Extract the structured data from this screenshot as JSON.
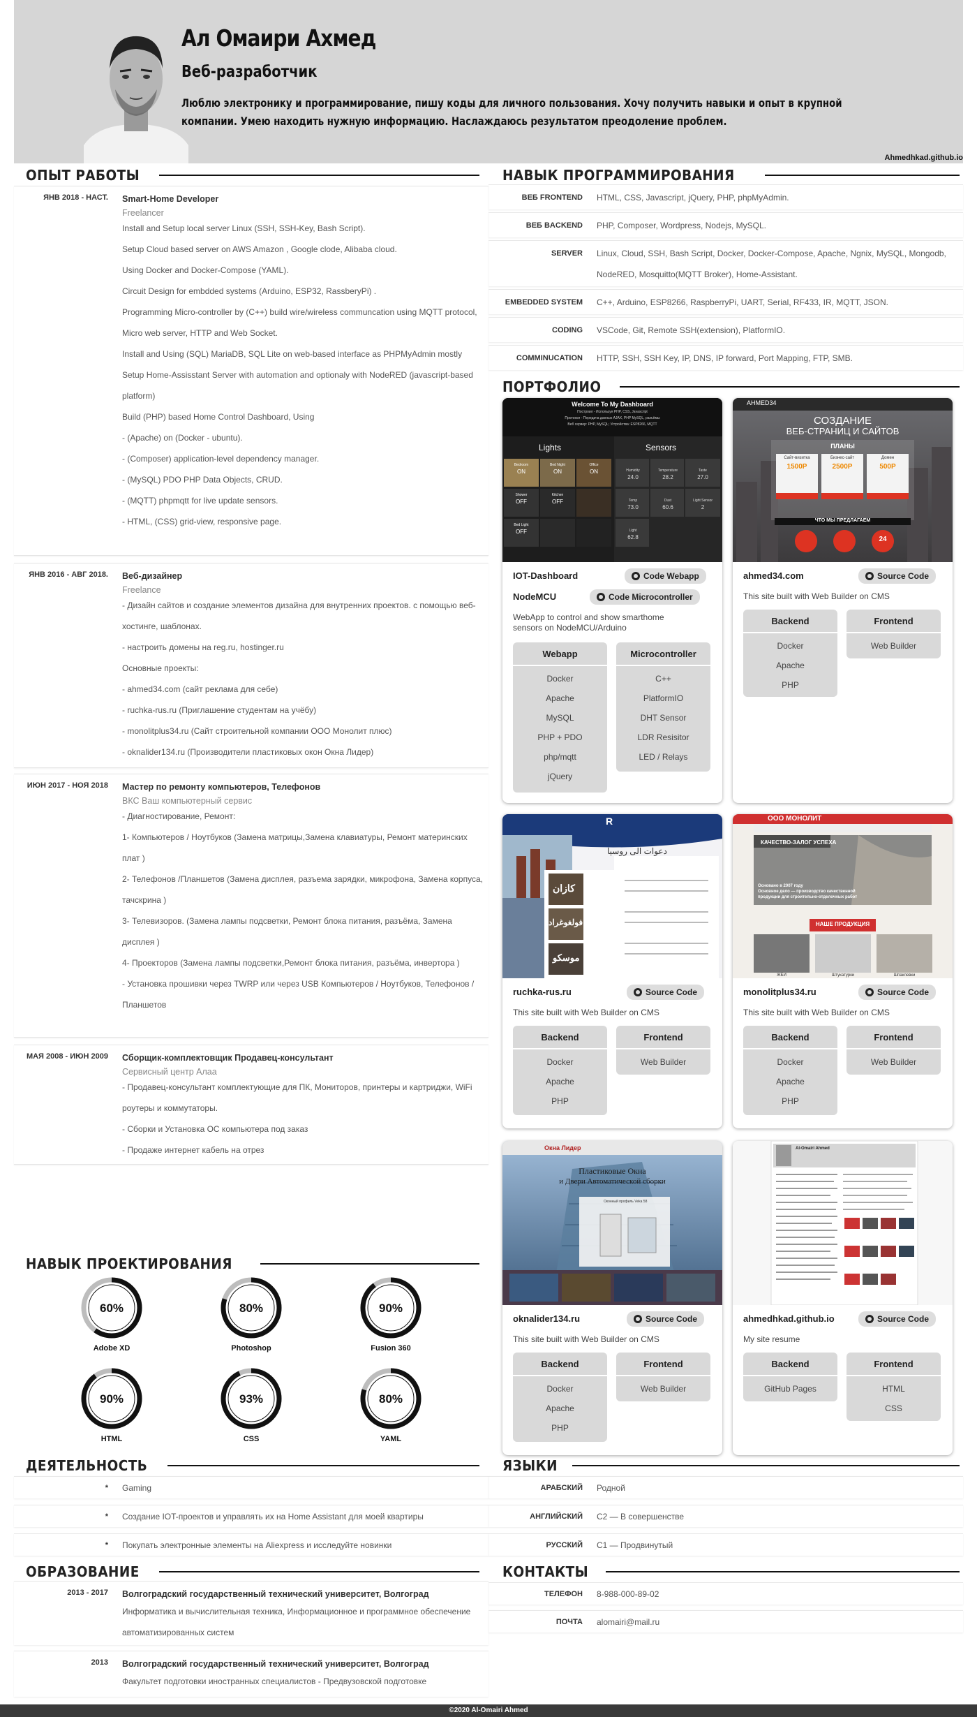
{
  "header": {
    "name": "Ал Омаири Ахмед",
    "title": "Веб-разработчик",
    "about": "Люблю электронику и программирование, пишу коды для личного пользования. Хочу получить навыки и опыт в крупной компании. Умею находить нужную информацию. Наслаждаюсь результатом преодоление проблем.",
    "site": "Ahmedhkad.github.io"
  },
  "sections": {
    "work": "ОПЫТ РАБОТЫ",
    "programming": "НАВЫК ПРОГРАММИРОВАНИЯ",
    "portfolio": "ПОРТФОЛИО",
    "design": "НАВЫК ПРОЕКТИРОВАНИЯ",
    "activity": "ДЕЯТЕЛЬНОСТЬ",
    "languages": "ЯЗЫКИ",
    "education": "ОБРАЗОВАНИЕ",
    "contacts": "КОНТАКТЫ"
  },
  "jobs": [
    {
      "date": "ЯНВ 2018 - НАСТ.",
      "role": "Smart-Home Developer",
      "company": "Freelancer",
      "lines": [
        "Install and Setup local server Linux (SSH, SSH-Key, Bash Script).",
        "Setup Cloud based server on AWS Amazon , Google clode, Alibaba cloud.",
        "Using Docker and Docker-Compose (YAML).",
        "Circuit Design for embdded systems (Arduino, ESP32, RassberyPi) .",
        "Programming Micro-controller by (C++) build wire/wireless communcation using MQTT protocol, Micro web server, HTTP and Web Socket.",
        "Install and Using (SQL) MariaDB, SQL Lite on web-based interface as PHPMyAdmin mostly",
        "Setup Home-Assisstant Server with automation and optionaly with NodeRED (javascript-based platform)",
        "Build (PHP) based Home Control Dashboard, Using",
        "- (Apache) on (Docker - ubuntu).",
        "- (Composer) application-level dependency manager.",
        "- (MySQL) PDO PHP Data Objects, CRUD.",
        "- (MQTT) phpmqtt for live update sensors.",
        "- HTML, (CSS) grid-view, responsive page."
      ]
    },
    {
      "date": "ЯНВ 2016 - АВГ 2018.",
      "role": "Веб-дизайнер",
      "company": "Freelance",
      "lines": [
        "- Дизайн сайтов и создание элементов дизайна для внутренних проектов. с помощью веб-хостинге, шаблонах.",
        "- настроить домены на reg.ru, hostinger.ru",
        "Основные проекты:",
        "- ahmed34.com (сайт реклама для себе)",
        "- ruchka-rus.ru (Приглашение студентам на учёбу)",
        "- monolitplus34.ru (Сайт строительной компании ООО Монолит плюс)",
        "- oknalider134.ru (Производители пластиковых окон Окна Лидер)"
      ]
    },
    {
      "date": "ИЮН 2017 - НОЯ 2018",
      "role": "Мастер по ремонту компьютеров, Телефонов",
      "company": "ВКС Ваш компьютерный сервис",
      "lines": [
        "- Диагностирование, Ремонт:",
        "1- Компьютеров / Ноутбуков (Замена матрицы,Замена клавиатуры, Ремонт материнских плат )",
        "2- Телефонов /Планшетов (Замена дисплея, разъема зарядки, микрофона, Замена корпуса, тачскрина )",
        "3- Телевизоров. (Замена лампы подсветки, Ремонт блока питания, разъёма, Замена дисплея )",
        "4- Проекторов (Замена лампы подсветки,Ремонт блока питания, разъёма, инвертора )",
        "- Установка прошивки через TWRP или через USB Компьютеров / Ноутбуков, Телефонов /Планшетов"
      ]
    },
    {
      "date": "МАЯ 2008 - ИЮН 2009",
      "role": "Сборщик-комплектовщик Продавец-консультант",
      "company": "Сервисный центр Алаа",
      "lines": [
        "- Продавец-консультант комплектующие для ПК, Мониторов, принтеры и картриджи, WiFi роутеры и коммутаторы.",
        "- Сборки и Установка ОС компьютера под заказ",
        "- Продаже интернет кабель на отрез"
      ]
    }
  ],
  "programming": [
    {
      "key": "ВЕБ FRONTEND",
      "value": "HTML, CSS, Javascript, jQuery, PHP, phpMyAdmin."
    },
    {
      "key": "ВЕБ BACKEND",
      "value": "PHP, Composer, Wordpress, Nodejs, MySQL."
    },
    {
      "key": "SERVER",
      "value": "Linux, Cloud, SSH, Bash Script, Docker, Docker-Compose, Apache, Ngnix, MySQL, Mongodb, NodeRED, Mosquitto(MQTT Broker), Home-Assistant."
    },
    {
      "key": "EMBEDDED SYSTEM",
      "value": "C++, Arduino, ESP8266, RaspberryPi, UART, Serial, RF433, IR, MQTT, JSON."
    },
    {
      "key": "CODING",
      "value": "VSCode, Git, Remote SSH(extension), PlatformIO."
    },
    {
      "key": "COMMINUCATION",
      "value": "HTTP, SSH, SSH Key, IP, DNS, IP forward, Port Mapping, FTP, SMB."
    }
  ],
  "portfolio": [
    {
      "name": "IOT-Dashboard",
      "btn": "Code Webapp",
      "name2": "NodeMCU",
      "btn2": "Code Microcontroller",
      "desc": "WebApp to control and show smarthome sensors on NodeMCU/Arduino",
      "backend_title": "Webapp",
      "backend": [
        "Docker",
        "Apache",
        "MySQL",
        "PHP + PDO",
        "php/mqtt",
        "jQuery"
      ],
      "frontend_title": "Microcontroller",
      "frontend": [
        "C++",
        "PlatformIO",
        "DHT Sensor",
        "LDR Resisitor",
        "LED / Relays"
      ],
      "shot": {
        "title": "Welcome To My Dashboard",
        "sub1": "Построил - Используя PHP, CSS, Javascript",
        "sub2": "Протокол - Передача данных AJAX, PHP MySQL, разъёмы",
        "sub3": "Веб сервер: PHP, MySQL; Устройства: ESP8266, MQTT",
        "lights": "Lights",
        "sensors": "Sensors",
        "tiles": [
          [
            "Bedroom",
            "ON"
          ],
          [
            "Bed Night",
            "ON"
          ],
          [
            "Office",
            "ON"
          ],
          [
            "Bed Light",
            "OFF"
          ],
          [
            "Shower",
            "OFF"
          ],
          [
            "Kitchen",
            "OFF"
          ]
        ],
        "sensor_tiles": [
          [
            "Humidity",
            "24.0"
          ],
          [
            "Temperature",
            "28.2"
          ],
          [
            "Taste",
            "27.0"
          ],
          [
            "Temp",
            "73.0"
          ],
          [
            "Dust",
            "60.6"
          ],
          [
            "Light Sensor",
            "2"
          ],
          [
            "Light",
            "62.8"
          ]
        ]
      }
    },
    {
      "name": "ahmed34.com",
      "btn": "Source Code",
      "desc": "This site built with Web Builder on CMS",
      "backend_title": "Backend",
      "backend": [
        "Docker",
        "Apache",
        "PHP"
      ],
      "frontend_title": "Frontend",
      "frontend": [
        "Web Builder"
      ],
      "shot": {
        "brand": "AHMED34",
        "head1": "СОЗДАНИЕ",
        "head2": "ВЕБ-СТРАНИЦ И САЙТОВ",
        "plans": "ПЛАНЫ",
        "p1": "Сайт-визитка",
        "p1v": "1500Р",
        "p2": "Бизнес-сайт",
        "p2v": "2500Р",
        "p3": "Домен",
        "p3v": "500Р",
        "offer": "ЧТО МЫ ПРЕДЛАГАЕМ",
        "badge": "24"
      }
    },
    {
      "name": "ruchka-rus.ru",
      "btn": "Source Code",
      "desc": "This site built with Web Builder on CMS",
      "backend_title": "Backend",
      "backend": [
        "Docker",
        "Apache",
        "PHP"
      ],
      "frontend_title": "Frontend",
      "frontend": [
        "Web Builder"
      ],
      "shot": {
        "logo": "R",
        "ar1": "دعوات الى روسيا",
        "ar2": "كازان",
        "ar3": "فولغوغراد",
        "ar4": "موسكو"
      }
    },
    {
      "name": "monolitplus34.ru",
      "btn": "Source Code",
      "desc": "This site built with Web Builder on CMS",
      "backend_title": "Backend",
      "backend": [
        "Docker",
        "Apache",
        "PHP"
      ],
      "frontend_title": "Frontend",
      "frontend": [
        "Web Builder"
      ],
      "shot": {
        "brand": "ООО МОНОЛИТ",
        "banner": "КАЧЕСТВО-ЗАЛОГ УСПЕХА",
        "l1": "Основано в 2007 году",
        "l2": "Основное дело — производство качественной",
        "l3": "продукции для строительно-отделочных работ",
        "cta": "НАШЕ ПРОДУКЦИЯ",
        "c1": "ЖБИ",
        "c2": "Штукатурки",
        "c3": "Шпаклевки"
      }
    },
    {
      "name": "oknalider134.ru",
      "btn": "Source Code",
      "desc": "This site built with Web Builder on CMS",
      "backend_title": "Backend",
      "backend": [
        "Docker",
        "Apache",
        "PHP"
      ],
      "frontend_title": "Frontend",
      "frontend": [
        "Web Builder"
      ],
      "shot": {
        "brand": "Окна Лидер",
        "h1": "Пластиковые Окна",
        "h2": "и Двери Автоматической сборки",
        "prof": "Оконный профиль Veka 58"
      }
    },
    {
      "name": "ahmedhkad.github.io",
      "btn": "Source Code",
      "desc": "My site resume",
      "backend_title": "Backend",
      "backend": [
        "GitHub Pages"
      ],
      "frontend_title": "Frontend",
      "frontend": [
        "HTML",
        "CSS"
      ],
      "shot": {
        "title": "Al-Omairi Ahmed"
      }
    }
  ],
  "design": [
    {
      "label": "Adobe XD",
      "value": 60,
      "text": "60%"
    },
    {
      "label": "Photoshop",
      "value": 80,
      "text": "80%"
    },
    {
      "label": "Fusion 360",
      "value": 90,
      "text": "90%"
    },
    {
      "label": "HTML",
      "value": 90,
      "text": "90%"
    },
    {
      "label": "CSS",
      "value": 93,
      "text": "93%"
    },
    {
      "label": "YAML",
      "value": 80,
      "text": "80%"
    }
  ],
  "activity": [
    {
      "bullet": "*",
      "text": "Gaming"
    },
    {
      "bullet": "*",
      "text": "Создание IOT-проектов и управлять их на Home Assistant для моей квартиры"
    },
    {
      "bullet": "*",
      "text": "Покупать электронные элементы на Aliexpress и исследуйте новинки"
    }
  ],
  "languages": [
    {
      "key": "АРАБСКИЙ",
      "value": "Родной"
    },
    {
      "key": "АНГЛИЙСКИЙ",
      "value": "C2 — В совершенстве"
    },
    {
      "key": "РУССКИЙ",
      "value": "C1 — Продвинутый"
    }
  ],
  "education": [
    {
      "year": "2013 - 2017",
      "school": "Волгоградский государственный технический университет, Волгоград",
      "lines": [
        "Информатика и вычислительная техника, Информационное и программное обеспечение автоматизированных систем"
      ]
    },
    {
      "year": "2013",
      "school": "Волгоградский государственный технический университет, Волгоград",
      "lines": [
        "Факультет подготовки иностранных специалистов - Предвузовской подготовке"
      ]
    }
  ],
  "contacts": [
    {
      "key": "ТЕЛЕФОН",
      "value": "8-988-000-89-02"
    },
    {
      "key": "ПОЧТА",
      "value": "alomairi@mail.ru"
    }
  ],
  "footer": "©2020 Al-Omairi Ahmed"
}
